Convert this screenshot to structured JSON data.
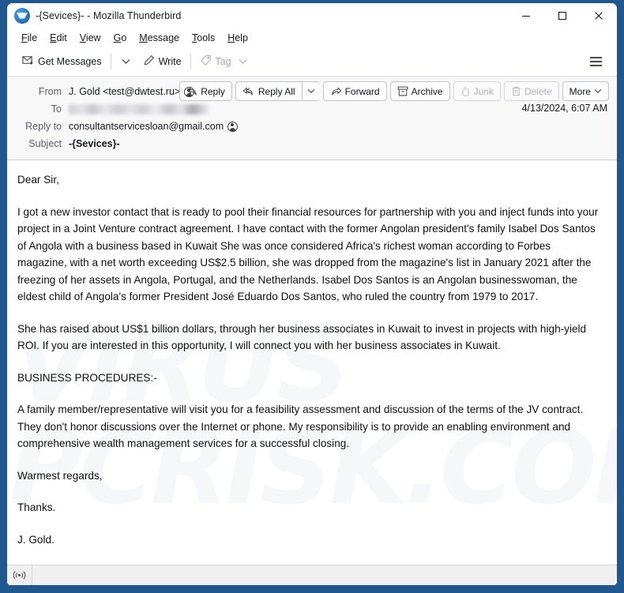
{
  "window": {
    "title": "-{Sevices}- - Mozilla Thunderbird",
    "app_icon": "thunderbird-logo-icon",
    "controls": {
      "minimize": "minimize-icon",
      "maximize": "maximize-icon",
      "close": "close-icon"
    }
  },
  "menubar": {
    "items": [
      {
        "label": "File",
        "accesskey": "F"
      },
      {
        "label": "Edit",
        "accesskey": "E"
      },
      {
        "label": "View",
        "accesskey": "V"
      },
      {
        "label": "Go",
        "accesskey": "G"
      },
      {
        "label": "Message",
        "accesskey": "M"
      },
      {
        "label": "Tools",
        "accesskey": "T"
      },
      {
        "label": "Help",
        "accesskey": "H"
      }
    ]
  },
  "toolbar": {
    "get_messages_label": "Get Messages",
    "get_messages_icon": "envelope-download-icon",
    "get_messages_caret_icon": "chevron-down-icon",
    "write_label": "Write",
    "write_icon": "pencil-icon",
    "tag_label": "Tag",
    "tag_icon": "tag-icon",
    "tag_caret_icon": "chevron-down-icon",
    "tag_disabled": true,
    "app_menu_icon": "hamburger-menu-icon"
  },
  "message_header": {
    "rows": [
      {
        "label": "From",
        "value": "J. Gold <test@dwtest.ru>",
        "has_contact_icon": true,
        "redacted": false,
        "bold": false
      },
      {
        "label": "To",
        "value": "",
        "has_contact_icon": false,
        "redacted": true,
        "bold": false
      },
      {
        "label": "Reply to",
        "value": "consultantservicesloan@gmail.com",
        "has_contact_icon": true,
        "redacted": false,
        "bold": false
      },
      {
        "label": "Subject",
        "value": "-{Sevices}-",
        "has_contact_icon": false,
        "redacted": false,
        "bold": true
      }
    ],
    "date": "4/13/2024, 6:07 AM"
  },
  "actions": [
    {
      "label": "Reply",
      "icon": "reply-arrow-icon",
      "disabled": false,
      "caret": false
    },
    {
      "label": "Reply All",
      "icon": "reply-all-arrow-icon",
      "disabled": false,
      "caret": true
    },
    {
      "label": "Forward",
      "icon": "forward-arrow-icon",
      "disabled": false,
      "caret": false
    },
    {
      "label": "Archive",
      "icon": "archive-box-icon",
      "disabled": false,
      "caret": false
    },
    {
      "label": "Junk",
      "icon": "junk-flame-icon",
      "disabled": true,
      "caret": false
    },
    {
      "label": "Delete",
      "icon": "trash-can-icon",
      "disabled": true,
      "caret": false
    },
    {
      "label": "More",
      "icon": "",
      "disabled": false,
      "caret": true
    }
  ],
  "body": {
    "watermark_text_1": "VIRUS",
    "watermark_text_2": "PCRISK.COM",
    "paragraphs": [
      "Dear Sir,",
      "I got a new investor contact that is ready to pool their financial resources for partnership with you and inject funds into your project in a Joint Venture contract agreement. I have contact with the former Angolan president's family Isabel Dos Santos of Angola with a business based in Kuwait She was once considered Africa's richest woman according to Forbes magazine, with a net worth exceeding US$2.5 billion, she was dropped from the magazine's list in January 2021 after the freezing of her assets in Angola, Portugal, and the Netherlands. Isabel Dos Santos is an Angolan businesswoman, the eldest child of Angola's former President José Eduardo Dos Santos, who ruled the country from 1979 to 2017.",
      "She has raised about US$1 billion dollars, through her business associates in Kuwait to invest in projects with high-yield ROI. If you are interested in this opportunity, I will connect you with her business associates in Kuwait.",
      "BUSINESS PROCEDURES:-",
      "A family member/representative will visit you for a feasibility assessment and discussion of the terms of the JV contract. They don't honor discussions over the Internet or phone. My responsibility is to provide an enabling environment and comprehensive wealth management services for a successful closing.",
      "Warmest regards,",
      "Thanks.",
      "J. Gold."
    ]
  },
  "statusbar": {
    "connection_icon": "broadcast-signal-icon",
    "text": ""
  },
  "colors": {
    "window_chrome": "#21578f",
    "header_bg": "#f8f8f9",
    "body_bg": "#ffffff",
    "text": "#101012",
    "muted_text": "#5c5c66",
    "disabled_text": "#b0b0b5"
  }
}
